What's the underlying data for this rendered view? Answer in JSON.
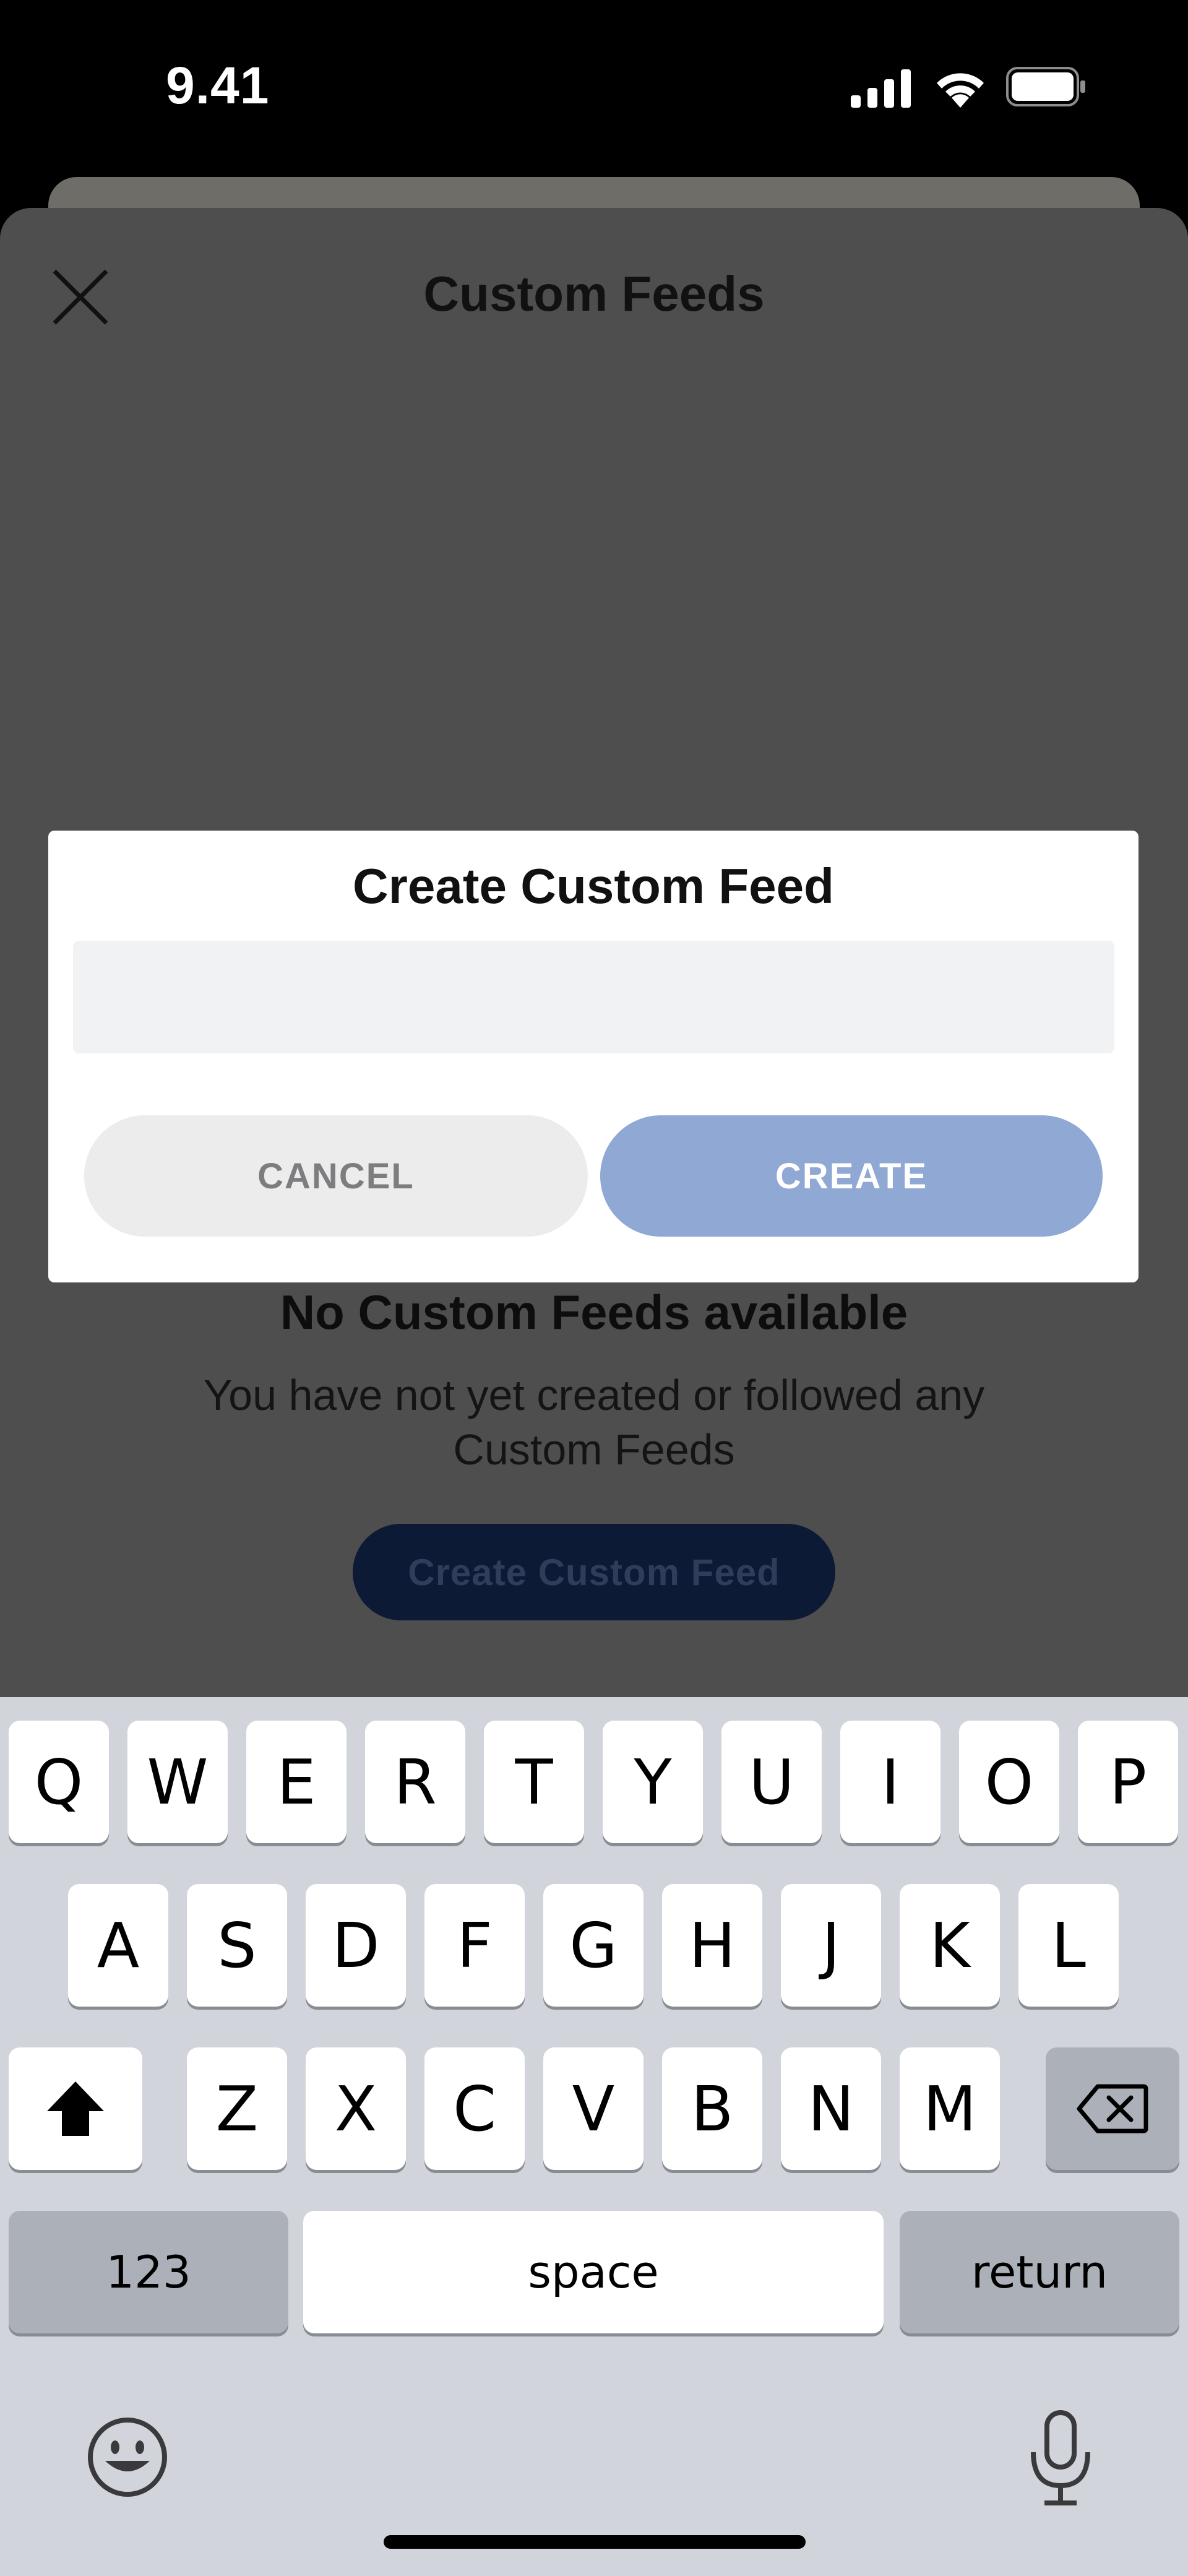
{
  "status_bar": {
    "time": "9.41"
  },
  "header": {
    "title": "Custom Feeds",
    "close_icon": "close-icon"
  },
  "empty_state": {
    "title": "No Custom Feeds available",
    "description": "You have not yet created or followed any Custom Feeds",
    "button_label": "Create Custom Feed"
  },
  "dialog": {
    "title": "Create Custom Feed",
    "input_value": "",
    "input_placeholder": "",
    "cancel_label": "CANCEL",
    "create_label": "CREATE"
  },
  "keyboard": {
    "row1": [
      "Q",
      "W",
      "E",
      "R",
      "T",
      "Y",
      "U",
      "I",
      "O",
      "P"
    ],
    "row2": [
      "A",
      "S",
      "D",
      "F",
      "G",
      "H",
      "J",
      "K",
      "L"
    ],
    "row3": [
      "Z",
      "X",
      "C",
      "V",
      "B",
      "N",
      "M"
    ],
    "numbers_label": "123",
    "space_label": "space",
    "return_label": "return"
  },
  "colors": {
    "dialog_create": "#8fa8d4",
    "dialog_cancel": "#ececed",
    "overlay": "#4e4e4e",
    "keyboard_bg": "#d1d4da"
  }
}
